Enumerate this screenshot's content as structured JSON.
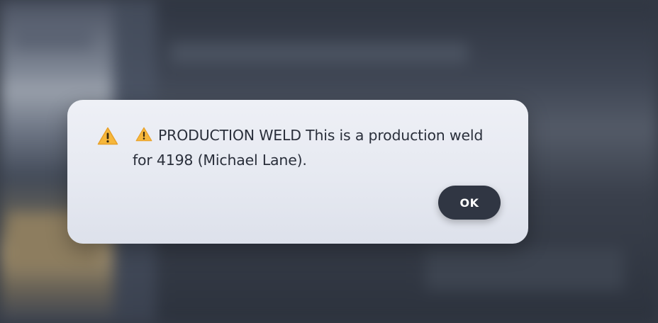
{
  "dialog": {
    "icon": "warning-icon",
    "message_icon": "warning-icon",
    "message": "PRODUCTION WELD This is a production weld for 4198 (Michael Lane).",
    "ok_label": "OK"
  },
  "colors": {
    "warning_fill": "#f6b73c",
    "warning_mark": "#3a2a10",
    "button_bg": "#303643",
    "button_text": "#ffffff",
    "dialog_bg": "#e9ecf3",
    "message_text": "#2a2f3b"
  }
}
